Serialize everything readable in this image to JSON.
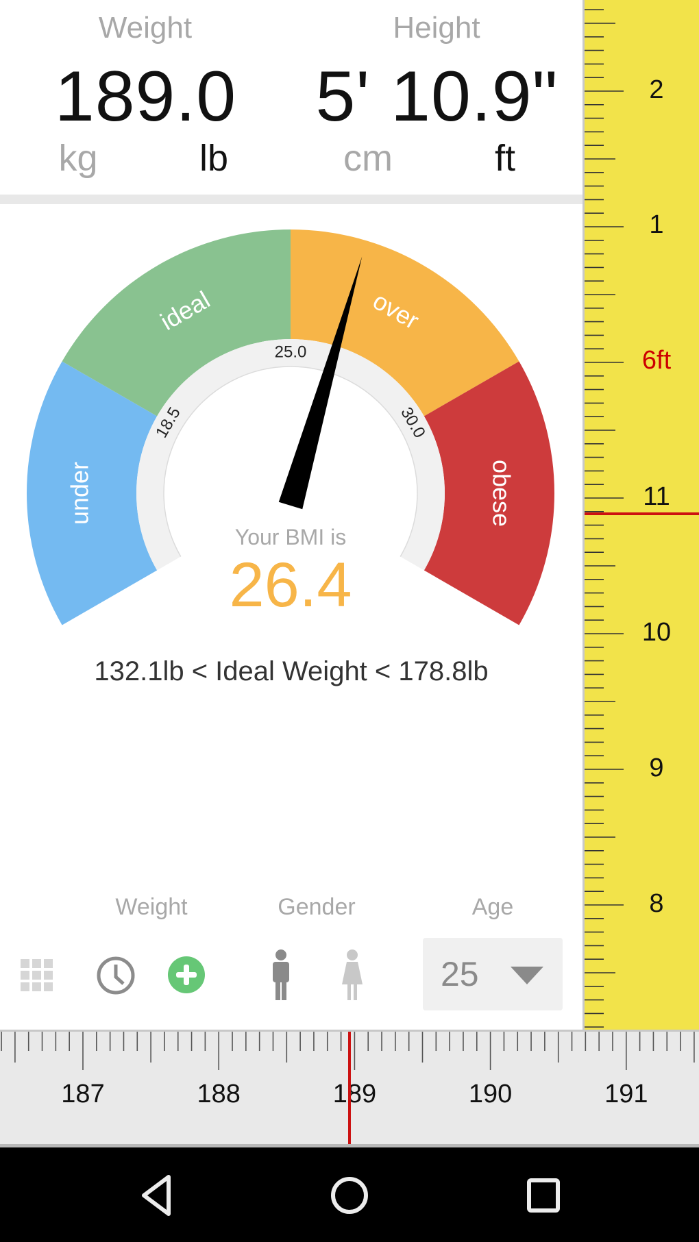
{
  "header": {
    "weight": {
      "label": "Weight",
      "value": "189.0",
      "units": [
        {
          "label": "kg",
          "selected": false
        },
        {
          "label": "lb",
          "selected": true
        }
      ]
    },
    "height": {
      "label": "Height",
      "value": "5' 10.9\"",
      "units": [
        {
          "label": "cm",
          "selected": false
        },
        {
          "label": "ft",
          "selected": true
        }
      ]
    }
  },
  "gauge": {
    "bmi_label": "Your BMI is",
    "bmi_value": "26.4",
    "bmi_numeric": 26.4,
    "bmi_color": "#f7b548",
    "zones": [
      {
        "name": "under",
        "color": "#74baf1"
      },
      {
        "name": "ideal",
        "color": "#89c290"
      },
      {
        "name": "over",
        "color": "#f7b548"
      },
      {
        "name": "obese",
        "color": "#cd3b3c"
      }
    ],
    "thresholds": [
      "18.5",
      "25.0",
      "30.0"
    ],
    "ideal_weight_text": "132.1lb < Ideal Weight < 178.8lb"
  },
  "controls": {
    "weight_label": "Weight",
    "gender_label": "Gender",
    "age_label": "Age",
    "age_value": "25",
    "add_color": "#66c776",
    "selected_gender": "male"
  },
  "height_ruler": {
    "labels": [
      "2",
      "1",
      "6ft",
      "11",
      "10",
      "9",
      "8"
    ],
    "highlight_label": "6ft",
    "highlight_color": "#cc0000",
    "indicator_color": "#cc1111"
  },
  "weight_ruler": {
    "labels": [
      "187",
      "188",
      "189",
      "190",
      "191"
    ],
    "indicator_color": "#cc1111"
  },
  "navbar": {
    "buttons": [
      "back",
      "home",
      "recents"
    ]
  }
}
